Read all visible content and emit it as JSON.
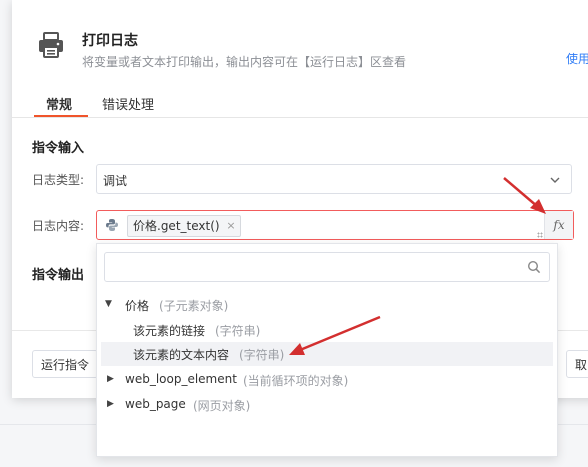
{
  "dialog": {
    "title": "打印日志",
    "subtitle": "将变量或者文本打印输出，输出内容可在【运行日志】区查看",
    "help_link": "使用"
  },
  "tabs": [
    {
      "label": "常规",
      "active": true
    },
    {
      "label": "错误处理",
      "active": false
    }
  ],
  "sections": {
    "input": "指令输入",
    "output": "指令输出"
  },
  "fields": {
    "log_type_label": "日志类型:",
    "log_type_value": "调试",
    "log_content_label": "日志内容:",
    "log_content_tag": "价格.get_text()",
    "tag_close": "×",
    "fx_button": "fx"
  },
  "footer": {
    "run_button": "运行指令",
    "cancel_button": "取"
  },
  "popup": {
    "search_placeholder": "",
    "items": [
      {
        "name": "价格",
        "type": "(子元素对象)",
        "expanded": true,
        "level": 0
      },
      {
        "name": "该元素的链接",
        "type": "(字符串)",
        "level": 1
      },
      {
        "name": "该元素的文本内容",
        "type": "(字符串)",
        "level": 1,
        "highlighted": true
      },
      {
        "name": "web_loop_element",
        "type": "(当前循环项的对象)",
        "expanded": false,
        "level": 0
      },
      {
        "name": "web_page",
        "type": "(网页对象)",
        "expanded": false,
        "level": 0
      }
    ]
  },
  "colors": {
    "accent": "#f0542b",
    "error_border": "#f25c5c",
    "annotation_arrow": "#d32f2f",
    "link": "#2f7cf6"
  },
  "icons": [
    "printer-icon",
    "chevron-down-icon",
    "python-icon",
    "close-icon",
    "search-icon",
    "caret-down-icon",
    "caret-right-icon"
  ]
}
